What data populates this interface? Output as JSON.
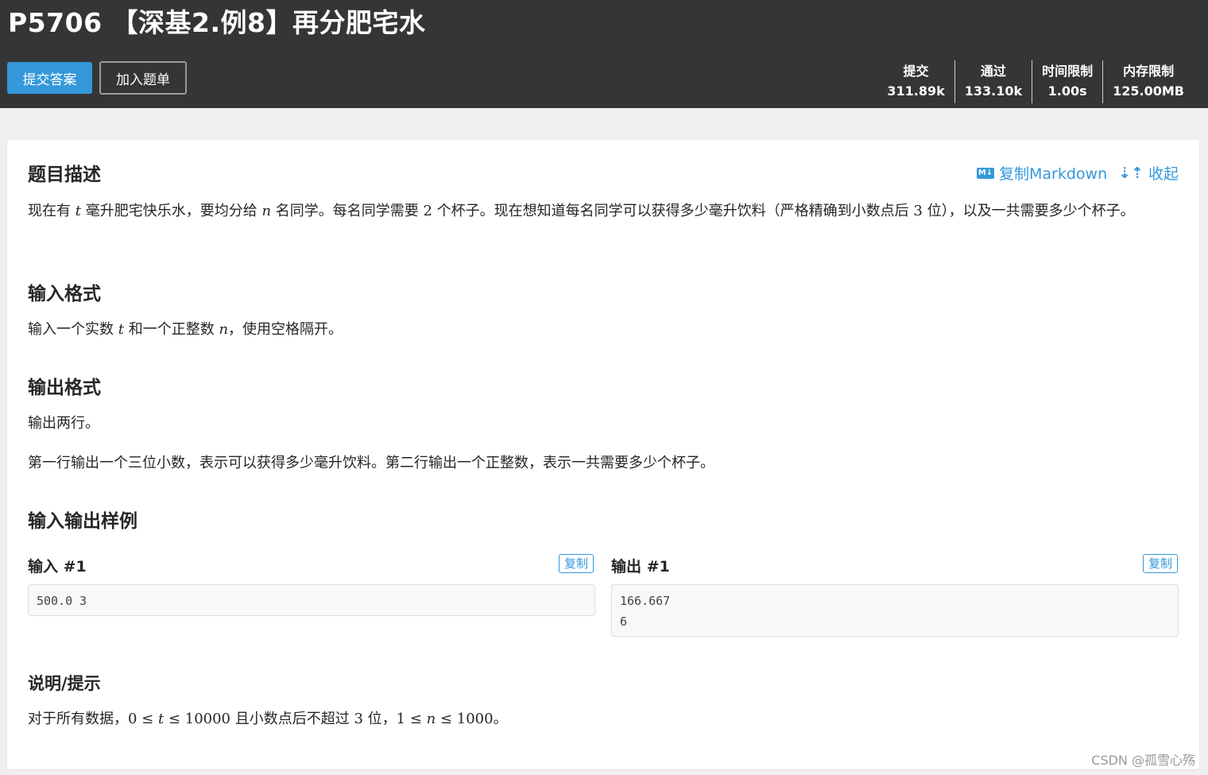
{
  "header": {
    "title": "P5706 【深基2.例8】再分肥宅水",
    "submit_button": "提交答案",
    "add_button": "加入题单",
    "stats": [
      {
        "label": "提交",
        "value": "311.89k"
      },
      {
        "label": "通过",
        "value": "133.10k"
      },
      {
        "label": "时间限制",
        "value": "1.00s"
      },
      {
        "label": "内存限制",
        "value": "125.00MB"
      }
    ]
  },
  "actions": {
    "md_icon_text": "M↓",
    "copy_markdown": "复制Markdown",
    "collapse_icon_text": "⇣⇡",
    "collapse": "收起"
  },
  "description": {
    "title": "题目描述",
    "p1": "现在有",
    "v_t": "t",
    "p2": "毫升肥宅快乐水，要均分给",
    "v_n": "n",
    "p3": "名同学。每名同学需要",
    "n2": "2",
    "p4": "个杯子。现在想知道每名同学可以获得多少毫升饮料（严格精确到小数点后",
    "n3": "3",
    "p5": "位），以及一共需要多少个杯子。"
  },
  "input_format": {
    "title": "输入格式",
    "p1": "输入一个实数",
    "v_t": "t",
    "p2": "和一个正整数",
    "v_n": "n",
    "p3": "，使用空格隔开。"
  },
  "output_format": {
    "title": "输出格式",
    "line1": "输出两行。",
    "line2": "第一行输出一个三位小数，表示可以获得多少毫升饮料。第二行输出一个正整数，表示一共需要多少个杯子。"
  },
  "samples": {
    "title": "输入输出样例",
    "input_label": "输入 #1",
    "output_label": "输出 #1",
    "copy_label": "复制",
    "input_text": "500.0 3",
    "output_text": "166.667\n6"
  },
  "hint": {
    "title": "说明/提示",
    "p1": "对于所有数据，",
    "m1": "0 ≤ ",
    "v_t": "t",
    "m2": " ≤ 10000",
    "p2": " 且小数点后不超过 ",
    "n3": "3",
    "p3": " 位，",
    "m3": "1 ≤ ",
    "v_n": "n",
    "m4": " ≤ 1000",
    "p4": "。"
  },
  "watermark": "CSDN @孤雪心殇"
}
